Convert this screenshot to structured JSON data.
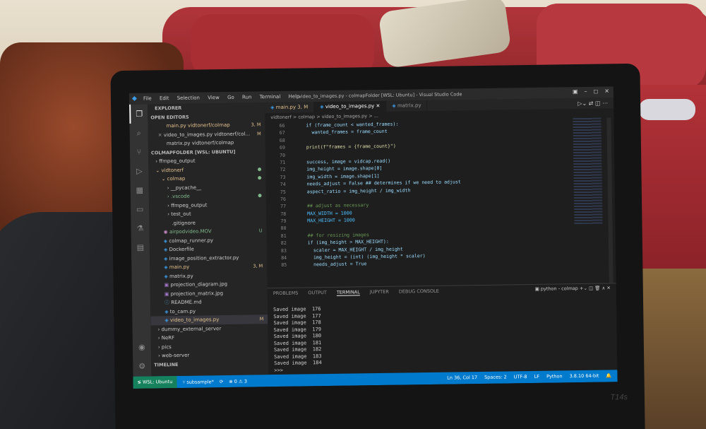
{
  "titlebar": {
    "menu": [
      "File",
      "Edit",
      "Selection",
      "View",
      "Go",
      "Run",
      "Terminal",
      "Help"
    ],
    "title": "video_to_images.py - colmapFolder [WSL: Ubuntu] - Visual Studio Code"
  },
  "sidebar": {
    "explorer": "EXPLORER",
    "open_editors": "OPEN EDITORS",
    "folder": "COLMAPFOLDER [WSL: UBUNTU]",
    "timeline": "TIMELINE",
    "items": [
      {
        "label": "main.py vidtonerf/colmap",
        "badge": "3, M"
      },
      {
        "label": "video_to_images.py vidtonerf/col...",
        "badge": "M"
      },
      {
        "label": "matrix.py vidtonerf/colmap",
        "badge": ""
      },
      {
        "label": "ffmpeg_output",
        "badge": ""
      },
      {
        "label": "vidtonerf",
        "badge": "●"
      },
      {
        "label": "colmap",
        "badge": "●"
      },
      {
        "label": "__pycache__",
        "badge": ""
      },
      {
        "label": ".vscode",
        "badge": "●"
      },
      {
        "label": "ffmpeg_output",
        "badge": ""
      },
      {
        "label": "test_out",
        "badge": ""
      },
      {
        "label": ".gitignore",
        "badge": ""
      },
      {
        "label": "airpodvideo.MOV",
        "badge": "U"
      },
      {
        "label": "colmap_runner.py",
        "badge": ""
      },
      {
        "label": "Dockerfile",
        "badge": ""
      },
      {
        "label": "image_position_extractor.py",
        "badge": ""
      },
      {
        "label": "main.py",
        "badge": "3, M"
      },
      {
        "label": "matrix.py",
        "badge": ""
      },
      {
        "label": "projection_diagram.jpg",
        "badge": ""
      },
      {
        "label": "projection_matrix.jpg",
        "badge": ""
      },
      {
        "label": "README.md",
        "badge": ""
      },
      {
        "label": "to_cam.py",
        "badge": ""
      },
      {
        "label": "video_to_images.py",
        "badge": "M"
      },
      {
        "label": "dummy_external_server",
        "badge": ""
      },
      {
        "label": "NeRF",
        "badge": ""
      },
      {
        "label": "pics",
        "badge": ""
      },
      {
        "label": "web-server",
        "badge": ""
      }
    ]
  },
  "editor": {
    "tabs": [
      "main.py 3, M",
      "video_to_images.py",
      "matrix.py"
    ],
    "breadcrumb": "vidtonerf > colmap > video_to_images.py > ...",
    "lines": [
      {
        "n": "66",
        "t": "    if (frame_count < wanted_frames):"
      },
      {
        "n": "67",
        "t": "      wanted_frames = frame_count"
      },
      {
        "n": "68",
        "t": ""
      },
      {
        "n": "69",
        "t": "    print(f\"frames = {frame_count}\")"
      },
      {
        "n": "70",
        "t": ""
      },
      {
        "n": "71",
        "t": "    success, image = vidcap.read()"
      },
      {
        "n": "72",
        "t": "    img_height = image.shape[0]"
      },
      {
        "n": "73",
        "t": "    img_width = image.shape[1]"
      },
      {
        "n": "74",
        "t": "    needs_adjust = False ## determines if we need to adjust"
      },
      {
        "n": "75",
        "t": "    aspect_ratio = img_height / img_width"
      },
      {
        "n": "76",
        "t": ""
      },
      {
        "n": "77",
        "t": "    ## adjust as necessary"
      },
      {
        "n": "78",
        "t": "    MAX_WIDTH = 1000"
      },
      {
        "n": "79",
        "t": "    MAX_HEIGHT = 1000"
      },
      {
        "n": "80",
        "t": ""
      },
      {
        "n": "81",
        "t": "    ## for resizing images"
      },
      {
        "n": "82",
        "t": "    if (img_height > MAX_HEIGHT):"
      },
      {
        "n": "83",
        "t": "      scaler = MAX_HEIGHT / img_height"
      },
      {
        "n": "84",
        "t": "      img_height = (int) (img_height * scaler)"
      },
      {
        "n": "85",
        "t": "      needs_adjust = True"
      }
    ]
  },
  "panel": {
    "tabs": [
      "PROBLEMS",
      "OUTPUT",
      "TERMINAL",
      "JUPYTER",
      "DEBUG CONSOLE"
    ],
    "shell": "python - colmap",
    "terminal": [
      "Saved image  176",
      "Saved image  177",
      "Saved image  178",
      "Saved image  179",
      "Saved image  180",
      "Saved image  181",
      "Saved image  182",
      "Saved image  183",
      "Saved image  184",
      ">>> "
    ]
  },
  "statusbar": {
    "remote": "WSL: Ubuntu",
    "branch": "subsample*",
    "problems": "⊗ 0 ⚠ 3",
    "right": [
      "Ln 36, Col 17",
      "Spaces: 2",
      "UTF-8",
      "LF",
      "Python",
      "3.8.10 64-bit"
    ]
  },
  "laptop_logo": "T14s"
}
